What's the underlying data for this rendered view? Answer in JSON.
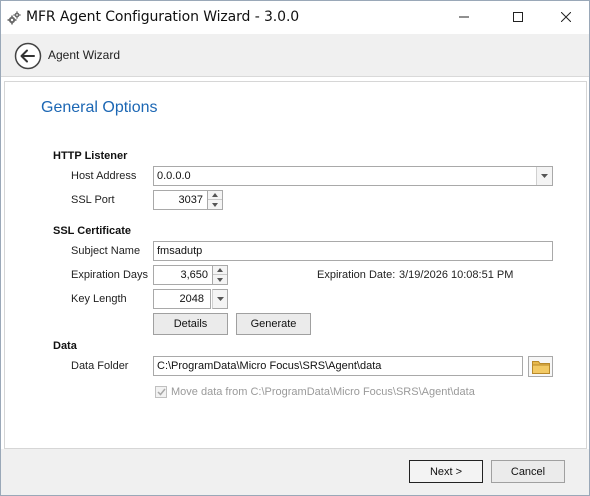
{
  "window": {
    "title": "MFR Agent Configuration Wizard - 3.0.0",
    "minimize_glyph": "—",
    "maximize_glyph": "☐",
    "close_glyph": "✕"
  },
  "header": {
    "title": "Agent Wizard",
    "back_icon": "back-arrow-icon"
  },
  "page": {
    "title": "General Options"
  },
  "http_listener": {
    "section_title": "HTTP Listener",
    "host_address_label": "Host Address",
    "host_address_value": "0.0.0.0",
    "ssl_port_label": "SSL Port",
    "ssl_port_value": "3037"
  },
  "ssl_certificate": {
    "section_title": "SSL Certificate",
    "subject_name_label": "Subject Name",
    "subject_name_value": "fmsadutp",
    "expiration_days_label": "Expiration Days",
    "expiration_days_value": "3,650",
    "expiration_date_label": "Expiration Date:",
    "expiration_date_value": "3/19/2026 10:08:51 PM",
    "key_length_label": "Key Length",
    "key_length_value": "2048",
    "details_button": "Details",
    "generate_button": "Generate"
  },
  "data": {
    "section_title": "Data",
    "data_folder_label": "Data Folder",
    "data_folder_value": "C:\\ProgramData\\Micro Focus\\SRS\\Agent\\data",
    "move_data_label": "Move data from C:\\ProgramData\\Micro Focus\\SRS\\Agent\\data",
    "move_data_checked": true,
    "move_data_enabled": false
  },
  "footer": {
    "next_button": "Next >",
    "cancel_button": "Cancel"
  },
  "colors": {
    "accent_title": "#1c67b4",
    "disabled_text": "#9a9a9a",
    "header_bg": "#f0f0f0"
  }
}
